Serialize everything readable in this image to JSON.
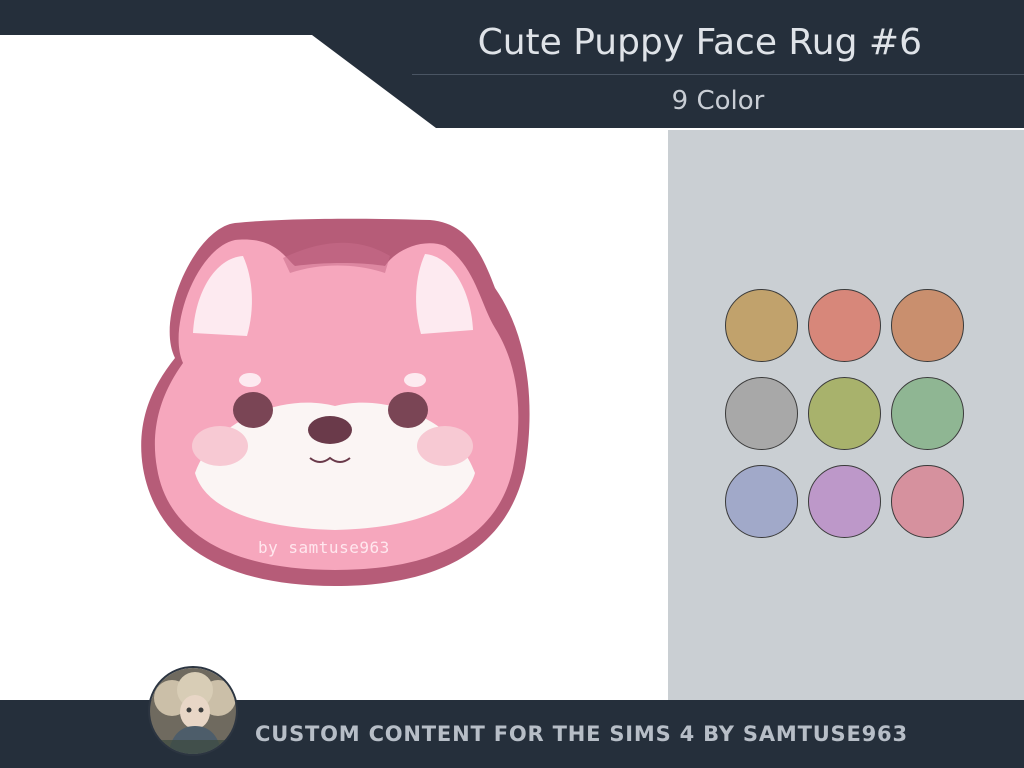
{
  "header": {
    "title": "Cute Puppy Face Rug #6",
    "subtitle": "9 Color"
  },
  "rug": {
    "watermark": "by samtuse963",
    "colors": {
      "fill": "#f6a7bd",
      "border": "#b65c78",
      "muzzle": "#fbf5f4",
      "eyes": "#7a4555",
      "nose": "#6a3a4a",
      "cheeks": "#f7c9d3",
      "ear_inner": "#fdeaf0"
    }
  },
  "swatches": [
    {
      "name": "ochre",
      "color": "#c1a26c"
    },
    {
      "name": "coral",
      "color": "#d7877a"
    },
    {
      "name": "terracotta",
      "color": "#c98f6e"
    },
    {
      "name": "grey",
      "color": "#a8a8a8"
    },
    {
      "name": "olive",
      "color": "#a8b26c"
    },
    {
      "name": "sage",
      "color": "#8fb693"
    },
    {
      "name": "periwinkle",
      "color": "#a1a9c9"
    },
    {
      "name": "lavender",
      "color": "#bd98c9"
    },
    {
      "name": "rose",
      "color": "#d6919e"
    }
  ],
  "footer": {
    "text": "CUSTOM CONTENT FOR THE SIMS 4 BY SAMTUSE963"
  },
  "theme": {
    "banner": "#252f3b",
    "panel": "#cacfd3",
    "title_text": "#dfe3e8"
  }
}
